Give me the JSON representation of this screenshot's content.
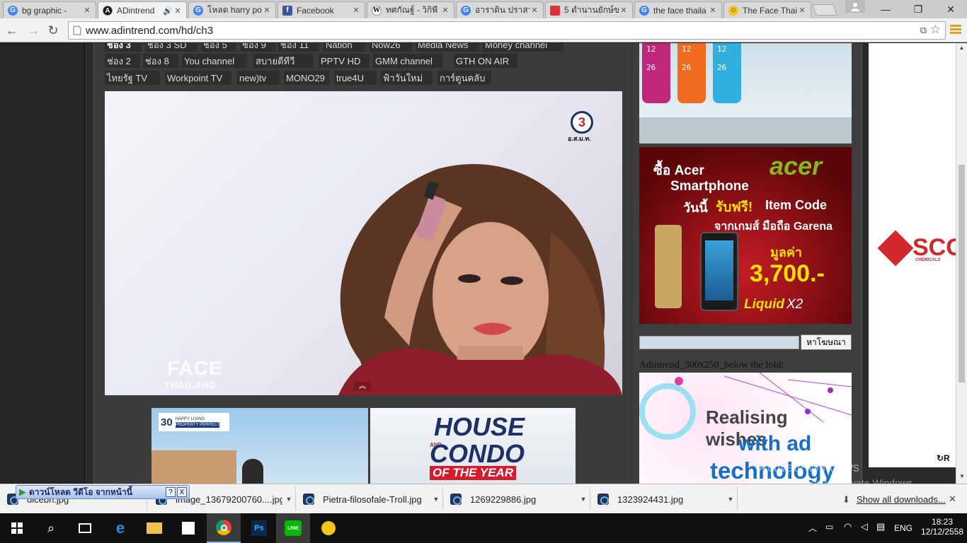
{
  "tabs": [
    {
      "title": "bg graphic - ",
      "favicon": "google-icon",
      "active": false
    },
    {
      "title": "ADintrend",
      "favicon": "adintrend-icon",
      "active": true
    },
    {
      "title": "โหลด harry po",
      "favicon": "google-icon",
      "active": false
    },
    {
      "title": "Facebook",
      "favicon": "facebook-icon",
      "active": false
    },
    {
      "title": "ทศกัณฐ์ - วิกิพี",
      "favicon": "wikipedia-icon",
      "active": false
    },
    {
      "title": "อาราดิน ปราสา",
      "favicon": "google-icon",
      "active": false
    },
    {
      "title": "5 ตำนานยักษ์ข",
      "favicon": "page-icon",
      "active": false
    },
    {
      "title": "the face thaila",
      "favicon": "google-icon",
      "active": false
    },
    {
      "title": "The Face Thai",
      "favicon": "emoji-icon",
      "active": false
    }
  ],
  "window_controls": {
    "minimize": "—",
    "maximize": "❐",
    "close": "✕"
  },
  "address": {
    "url": "www.adintrend.com/hd/ch3"
  },
  "channels": {
    "row1": [
      "ช่อง 3",
      "ช่อง 3 SD",
      "ช่อง 5",
      "ช่อง 9",
      "ช่อง 11",
      "Nation",
      "Now26",
      "Media News",
      "Money channel"
    ],
    "row2": [
      "ช่อง 2",
      "ช่อง 8",
      "You channel",
      "สบายดีทีวี",
      "PPTV HD",
      "GMM channel",
      "GTH ON AIR"
    ],
    "row3": [
      "ไทยรัฐ TV",
      "Workpoint TV",
      "new)tv",
      "MONO29",
      "true4U",
      "ฟ้าวันใหม่",
      "การ์ตูนคลับ"
    ]
  },
  "video": {
    "channel_logo": "3",
    "channel_logo_sub": "อ.ส.ม.ท.",
    "show_title": "FACE",
    "show_subtitle": "THAILAND"
  },
  "banner_left": {
    "badge": "30",
    "badge_text": "HAPPY LIVING",
    "badge_sub": "PROPERTY PERFECT"
  },
  "banner_right": {
    "line1": "HOUSE",
    "and": "AND",
    "line2": "CONDO",
    "line3": "OF THE YEAR"
  },
  "ad_watch": {
    "digits": [
      "12",
      "26",
      "12",
      "26",
      "12",
      "26"
    ]
  },
  "ad_acer": {
    "l1": "ซื้อ Acer",
    "l2": "Smartphone",
    "l3a": "วันนี้",
    "l3b": "รับฟรี!",
    "l3c": "Item Code",
    "l4": "จากเกมส์ มือถือ Garena",
    "brand": "acer",
    "price_label": "มูลค่า",
    "price": "3,700.-",
    "model_a": "Liquid",
    "model_b": "X2"
  },
  "search": {
    "value": "",
    "button": "หาโฆษณา"
  },
  "below_fold_label": "Adintrend_300x250_below the fold:",
  "ad_tech": {
    "l1": "Realising wishes",
    "l2": "with ad",
    "l3": "technology"
  },
  "side_ad": {
    "brand": "SCG",
    "sub": "CHEMICALS",
    "refresh": "↻R"
  },
  "watermark": {
    "l1": "Activate Windows",
    "l2": "Go to Settings to activate Windows."
  },
  "overlay_button": {
    "label": "ดาวน์โหลด วีดีโอ จากหน้านี้",
    "help": "?",
    "close": "X"
  },
  "downloads": {
    "items": [
      "dlcebn.jpg",
      "image_13679200760....jpg",
      "Pietra-filosofale-Troll.jpg",
      "1269229886.jpg",
      "1323924431.jpg"
    ],
    "show_all": "Show all downloads...",
    "close": "✕"
  },
  "taskbar": {
    "lang": "ENG",
    "time": "18:23",
    "date": "12/12/2558"
  },
  "colors": {
    "acer_green": "#83b81a",
    "acer_red": "#b0101a",
    "scg_red": "#d0282d",
    "ad_pink": "#e040a0",
    "ad_blue": "#1470c8"
  }
}
